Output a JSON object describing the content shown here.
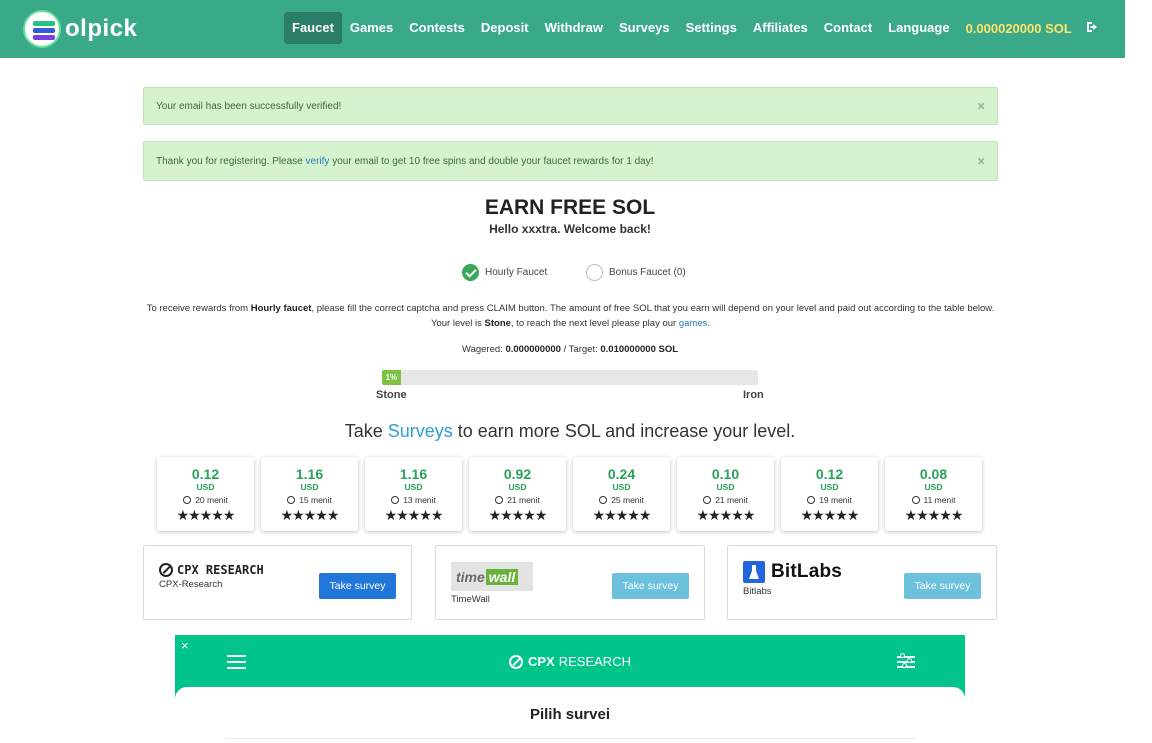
{
  "brand": {
    "logo_text": "olpick",
    "colors": {
      "nav": "#3aa98a",
      "nav_active": "#2a7d66",
      "balance": "#ffe36a",
      "success": "#d7f2cf",
      "accent": "#2aa05a",
      "cpx": "#00c48a"
    }
  },
  "nav": {
    "items": [
      {
        "label": "Faucet",
        "active": true
      },
      {
        "label": "Games"
      },
      {
        "label": "Contests"
      },
      {
        "label": "Deposit"
      },
      {
        "label": "Withdraw"
      },
      {
        "label": "Surveys"
      },
      {
        "label": "Settings"
      },
      {
        "label": "Affiliates"
      },
      {
        "label": "Contact"
      },
      {
        "label": "Language"
      }
    ],
    "balance": "0.000020000 SOL",
    "logout_icon": "sign-out-icon"
  },
  "alerts": {
    "verified": "Your email has been successfully verified!",
    "register_pre": "Thank you for registering. Please ",
    "register_link": "verify",
    "register_post": " your email to get 10 free spins and double your faucet rewards for 1 day!",
    "close": "×"
  },
  "main": {
    "title": "EARN FREE SOL",
    "subtitle": "Hello xxxtra. Welcome back!",
    "radios": [
      {
        "label": "Hourly Faucet",
        "checked": true
      },
      {
        "label": "Bonus Faucet (0)",
        "checked": false
      }
    ],
    "info": {
      "p1": "To receive rewards from ",
      "b1": "Hourly faucet",
      "p2": ", please fill the correct captcha and press CLAIM button. The amount of free SOL that you earn will depend on your level and paid out according to the table below. Your level is ",
      "b2": "Stone",
      "p3": ", to reach the next level please play our ",
      "link": "games",
      "p4": "."
    },
    "wager": {
      "wagered_label": "Wagered: ",
      "wagered_value": "0.000000000",
      "target_label": " / Target: ",
      "target_value": "0.010000000 SOL"
    },
    "progress": {
      "label": "1%",
      "value_percent": 1
    },
    "level_current": "Stone",
    "level_next": "Iron"
  },
  "surveys": {
    "title_pre": "Take ",
    "title_link": "Surveys",
    "title_post": " to earn more SOL and increase your level.",
    "offers": [
      {
        "amount": "0.12",
        "currency": "USD",
        "time": "20 menit",
        "stars": "★★★★★"
      },
      {
        "amount": "1.16",
        "currency": "USD",
        "time": "15 menit",
        "stars": "★★★★★"
      },
      {
        "amount": "1.16",
        "currency": "USD",
        "time": "13 menit",
        "stars": "★★★★★"
      },
      {
        "amount": "0.92",
        "currency": "USD",
        "time": "21 menit",
        "stars": "★★★★★"
      },
      {
        "amount": "0.24",
        "currency": "USD",
        "time": "25 menit",
        "stars": "★★★★★"
      },
      {
        "amount": "0.10",
        "currency": "USD",
        "time": "21 menit",
        "stars": "★★★★★"
      },
      {
        "amount": "0.12",
        "currency": "USD",
        "time": "19 menit",
        "stars": "★★★★★"
      },
      {
        "amount": "0.08",
        "currency": "USD",
        "time": "11 menit",
        "stars": "★★★★★"
      }
    ],
    "providers": [
      {
        "logo": "CPX RESEARCH",
        "name": "CPX-Research",
        "button": "Take survey"
      },
      {
        "logo_a": "time",
        "logo_b": "wall",
        "name": "TimeWall",
        "button": "Take survey"
      },
      {
        "logo": "BitLabs",
        "name": "Bitlabs",
        "button": "Take survey"
      }
    ]
  },
  "cpx_widget": {
    "close": "×",
    "brand_bold": "CPX",
    "brand_rest": "RESEARCH",
    "panel_title": "Pilih survei"
  }
}
